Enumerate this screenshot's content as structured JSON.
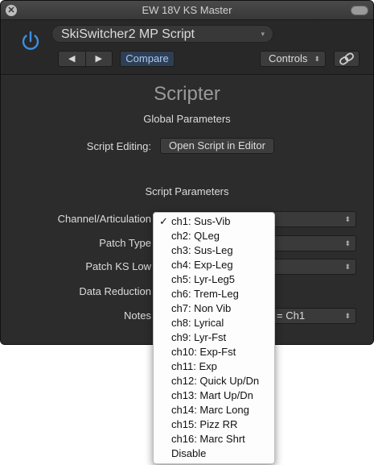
{
  "window": {
    "title": "EW 18V KS Master",
    "close_glyph": "✕"
  },
  "header": {
    "preset_name": "SkiSwitcher2 MP Script",
    "preset_arrow": "▾",
    "prev_glyph": "◀",
    "next_glyph": "▶",
    "compare_label": "Compare",
    "controls_label": "Controls",
    "updown_glyph": "⬍",
    "power_icon": "power-icon",
    "link_icon": "link-icon",
    "accent_color": "#3d8fe0"
  },
  "main": {
    "plugin_name": "Scripter",
    "global_title": "Global Parameters",
    "script_editing_label": "Script Editing:",
    "open_script_label": "Open Script in Editor",
    "script_params_title": "Script Parameters",
    "params": [
      {
        "label": "Channel/Articulation",
        "value": ""
      },
      {
        "label": "Patch Type",
        "value": ""
      },
      {
        "label": "Patch KS Low",
        "value": ""
      },
      {
        "label": "Data Reduction",
        "value": ""
      },
      {
        "label": "Notes",
        "value": "= Ch1"
      }
    ]
  },
  "menu": {
    "selected_index": 0,
    "check_glyph": "✓",
    "items": [
      "ch1:  Sus-Vib",
      "ch2:  QLeg",
      "ch3:  Sus-Leg",
      "ch4:  Exp-Leg",
      "ch5:  Lyr-Leg5",
      "ch6:  Trem-Leg",
      "ch7:  Non Vib",
      "ch8:  Lyrical",
      "ch9:  Lyr-Fst",
      "ch10:  Exp-Fst",
      "ch11:  Exp",
      "ch12:  Quick Up/Dn",
      "ch13:  Mart Up/Dn",
      "ch14:  Marc Long",
      "ch15:  Pizz RR",
      "ch16:  Marc Shrt",
      "Disable"
    ]
  }
}
